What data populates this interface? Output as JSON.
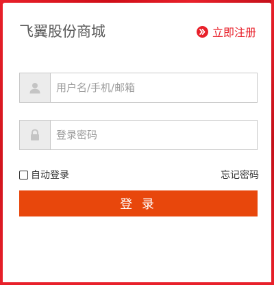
{
  "header": {
    "title": "飞翼股份商城",
    "register_label": "立即注册"
  },
  "form": {
    "username_placeholder": "用户名/手机/邮箱",
    "username_value": "",
    "password_placeholder": "登录密码",
    "password_value": "",
    "remember_label": "自动登录",
    "remember_checked": false,
    "forgot_label": "忘记密码",
    "submit_label": "登 录"
  },
  "icons": {
    "register": "chevron-right-circle-icon",
    "username": "user-icon",
    "password": "lock-icon"
  },
  "colors": {
    "frame_red": "#e8202a",
    "accent_red": "#e8202a",
    "button_orange": "#e8470c",
    "field_border": "#c8c8c8",
    "icon_box_bg": "#ececec",
    "title_gray": "#5a5a5a"
  }
}
